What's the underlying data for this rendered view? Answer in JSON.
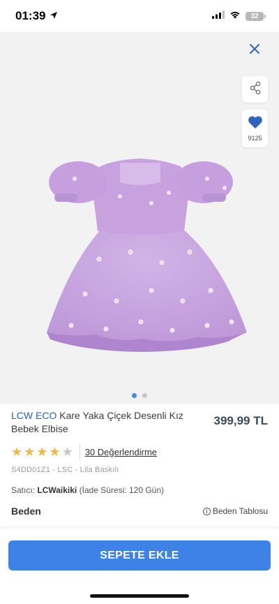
{
  "status": {
    "time": "01:39",
    "battery": "32"
  },
  "gallery": {
    "favorite_count": "9125",
    "page_count": 2,
    "active_page": 1
  },
  "product": {
    "brand": "LCW ECO",
    "name": "Kare Yaka Çiçek Desenli Kız Bebek Elbise",
    "price": "399,99 TL",
    "rating": 4,
    "rating_max": 5,
    "reviews_label": "30 Değerlendirme",
    "sku_line": "S4DD01Z1 - LSC - Lila Baskılı",
    "seller_label": "Satıcı:",
    "seller_name": "LCWaikiki",
    "return_info": "(İade Süresi: 120 Gün)"
  },
  "size": {
    "label": "Beden",
    "table_label": "Beden Tablosu"
  },
  "cart": {
    "button_label": "SEPETE EKLE"
  },
  "colors": {
    "brand_blue": "#1f66c9",
    "button_blue": "#3e82e8",
    "star": "#f5b935",
    "dress": "#c9a4e0"
  },
  "icons": [
    "location-arrow-icon",
    "signal-icon",
    "wifi-icon",
    "battery-icon",
    "close-icon",
    "share-icon",
    "heart-icon",
    "star-icon",
    "info-icon"
  ]
}
